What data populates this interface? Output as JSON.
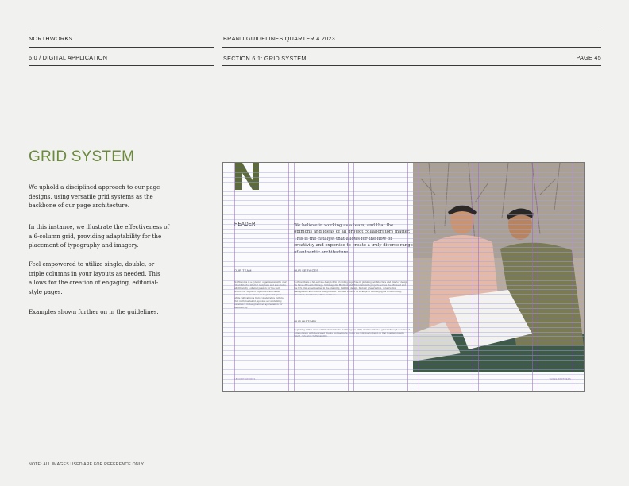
{
  "header": {
    "brand": "NORTHWORKS",
    "doc_title": "BRAND GUIDELINES QUARTER 4 2023",
    "chapter": "6.0 / DIGITAL APPLICATION",
    "section": "SECTION 6.1: GRID SYSTEM",
    "page": "PAGE 45"
  },
  "main": {
    "title": "GRID SYSTEM",
    "paragraphs": [
      "We uphold a disciplined approach to our page designs, using versatile grid systems as the backbone of our page architecture.",
      "In this instance, we illustrate the effectiveness of a 6-column grid, providing adaptability for the placement of typography and imagery.",
      "Feel empowered to utilize single, double, or triple columns in your layouts as needed. This allows for the creation of engaging, editorial-style pages.",
      "Examples shown further on in the guidelines."
    ]
  },
  "spread": {
    "header_label": "HEADER",
    "intro": "We believe in working as a team, and that the opinions and ideas of all project collaborators matter. This is the catalyst that allows for the flow of creativity and expertise to create a truly diverse range of authentic architecture.",
    "our_team_label": "OUR TEAM",
    "our_team_text": "Northworks is a dynamic organization with over 30 architects, interior designers and associates, all driven by a shared passion for the built world. Our depth of experience and talent within our team allows us to plan and grow while cultivating a truly collaborative culture that nurtures talent, upholds accountability, excellence in design and an appreciation for authenticity.",
    "our_services_label": "OUR SERVICES",
    "our_services_text": "Northworks is a full-service design firm providing expertise in planning, architecture and interior design. We have offices in Chicago, Minneapolis, Madison and Wisconsin with projects across the Midwest and the U.S. Our expertise lies in the planning, building design, historic preservation, construction management and interior design fields. We have worked on a range of building types from housing, education, healthcare, office and more.",
    "our_history_label": "OUR HISTORY",
    "our_history_text": "Beginning with a small architectural studio in Chicago in 1989, Northworks has grown through decades of collaboration with dedicated clients and partners. Today we continue to build on that foundation with talent, care and craftsmanship.",
    "footer_left": "18    NORTHWORKS",
    "footer_right": "THREE PARTNERS"
  },
  "footer": {
    "note": "NOTE: ALL IMAGES USED ARE FOR REFERENCE ONLY"
  },
  "colors": {
    "title_green": "#6b8a3a",
    "logo_green": "#5d6b3a",
    "grid_purple": "#9a66c8",
    "grid_blue": "#9ea4e8"
  }
}
